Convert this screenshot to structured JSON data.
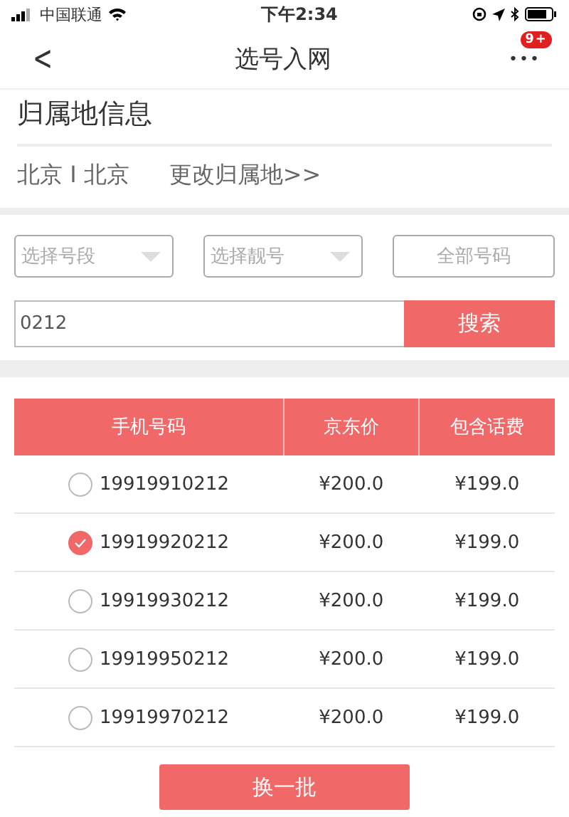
{
  "status_bar": {
    "carrier": "中国联通",
    "time": "下午2:34"
  },
  "nav": {
    "back": "<",
    "title": "选号入网",
    "more": "•••",
    "badge": "9+"
  },
  "location": {
    "heading": "归属地信息",
    "current": "北京 I 北京",
    "change_link": "更改归属地>>"
  },
  "filters": [
    {
      "kind": "dropdown",
      "placeholder": "选择号段"
    },
    {
      "kind": "dropdown",
      "placeholder": "选择靓号"
    },
    {
      "kind": "button",
      "label": "全部号码"
    }
  ],
  "search": {
    "value": "0212",
    "button": "搜索"
  },
  "table": {
    "columns": [
      "手机号码",
      "京东价",
      "包含话费"
    ],
    "rows": [
      {
        "number": "19919910212",
        "price": "¥200.0",
        "credit": "¥199.0",
        "selected": false
      },
      {
        "number": "19919920212",
        "price": "¥200.0",
        "credit": "¥199.0",
        "selected": true
      },
      {
        "number": "19919930212",
        "price": "¥200.0",
        "credit": "¥199.0",
        "selected": false
      },
      {
        "number": "19919950212",
        "price": "¥200.0",
        "credit": "¥199.0",
        "selected": false
      },
      {
        "number": "19919970212",
        "price": "¥200.0",
        "credit": "¥199.0",
        "selected": false
      }
    ]
  },
  "refresh_button": "换一批"
}
